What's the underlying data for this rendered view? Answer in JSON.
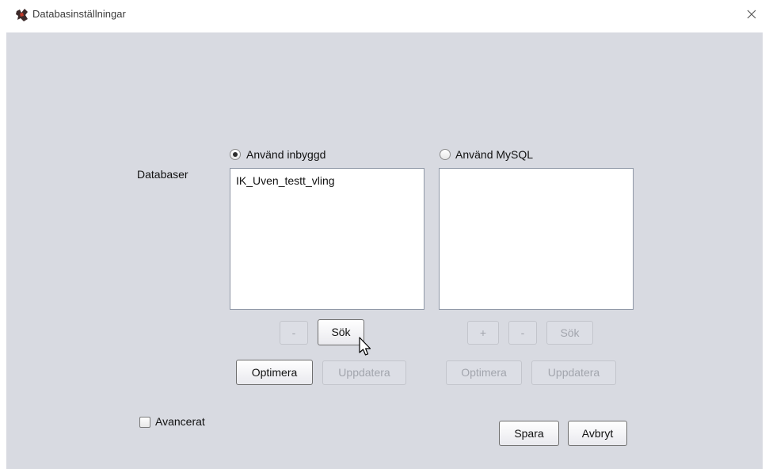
{
  "window": {
    "title": "Databasinställningar",
    "app_icon": "app-logo-icon",
    "close_icon": "close-icon"
  },
  "databases_label": "Databaser",
  "embedded": {
    "radio_label": "Använd inbyggd",
    "selected": true,
    "items": [
      "IK_Uven_testt_vling"
    ],
    "buttons": {
      "minus": "-",
      "search": "Sök",
      "optimize": "Optimera",
      "update": "Uppdatera"
    }
  },
  "mysql": {
    "radio_label": "Använd MySQL",
    "selected": false,
    "items": [],
    "buttons": {
      "plus": "+",
      "minus": "-",
      "search": "Sök",
      "optimize": "Optimera",
      "update": "Uppdatera"
    }
  },
  "advanced": {
    "label": "Avancerat",
    "checked": false
  },
  "footer": {
    "save": "Spara",
    "cancel": "Avbryt"
  },
  "colors": {
    "panel": "#d8dae1",
    "disabled_text": "#a2a5ad"
  }
}
